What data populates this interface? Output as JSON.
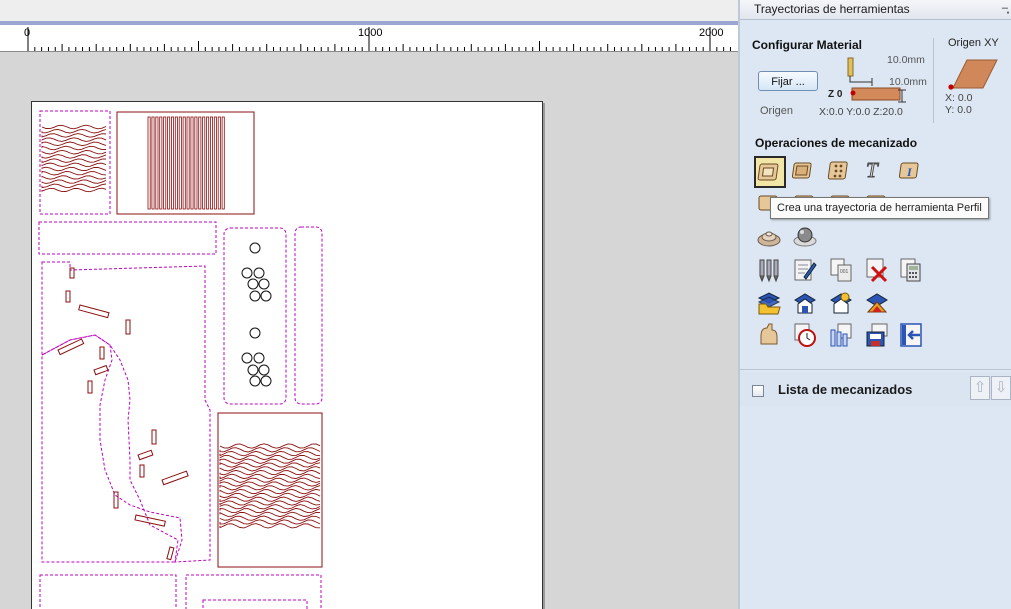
{
  "panel": {
    "title": "Trayectorias de herramientas",
    "material": {
      "section_title": "Configurar Material",
      "fix_button": "Fijar ...",
      "origin_label": "Origen",
      "thickness_top": "10.0mm",
      "thickness_bottom": "10.0mm",
      "z_label": "Z 0",
      "coords": "X:0.0 Y:0.0 Z:20.0"
    },
    "origin": {
      "title": "Origen XY",
      "x": "X: 0.0",
      "y": "Y: 0.0"
    },
    "operations": {
      "section_title": "Operaciones de mecanizado",
      "tooltip": "Crea una trayectoria de herramienta Perfil",
      "tools": [
        "profile-tool",
        "pocket-tool",
        "drill-tool",
        "vcarve-tool",
        "inlay-tool",
        "texture-tool",
        "fluting-tool",
        "prism-tool",
        "moulding-tool",
        "roughing-tool",
        "finishing-tool",
        "drill-group-tool",
        "edit-tool",
        "template-tool",
        "delete-tool",
        "calculator-tool",
        "save-folder-tool",
        "open-folder-tool",
        "merge-tool",
        "fold-tool",
        "tool-database-tool",
        "time-estimate-tool",
        "preview-tool",
        "save-toolpath-tool",
        "export-tool"
      ]
    },
    "toolpath_list": {
      "title": "Lista de mecanizados"
    }
  },
  "ruler": {
    "labels": [
      "0",
      "1000",
      "2000"
    ]
  },
  "colors": {
    "cut_lines": "#8b0f0f",
    "dashed_outline": "#c000c0",
    "panel_bg": "#dde7f3"
  }
}
